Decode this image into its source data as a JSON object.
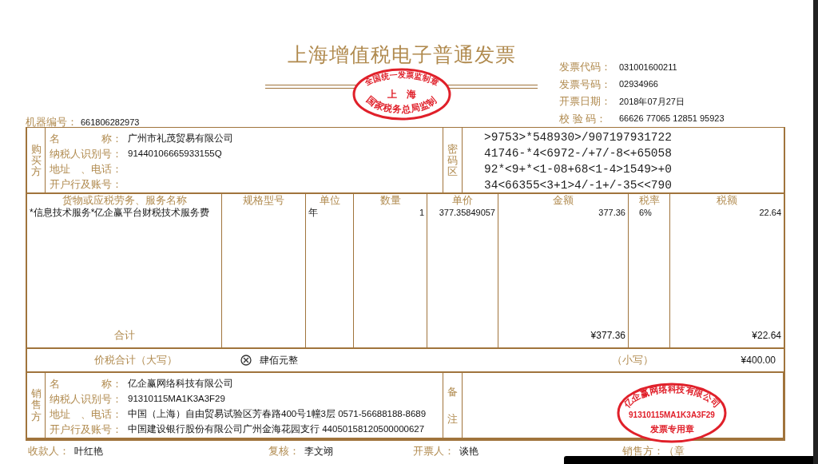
{
  "title": "上海增值税电子普通发票",
  "header_stamp": {
    "top_text": "全国统一发票监制章",
    "center_text": "上　海",
    "bottom_text": "国家税务总局监制"
  },
  "meta": [
    {
      "label": "发票代码：",
      "value": "031001600211"
    },
    {
      "label": "发票号码：",
      "value": "02934966"
    },
    {
      "label": "开票日期：",
      "value": "2018年07月27日"
    },
    {
      "label": "校 验 码：",
      "value": "66626 77065 12851 95923"
    }
  ],
  "machine_no": {
    "label": "机器编号：",
    "value": "661806282973"
  },
  "buyer": {
    "side_label": "购买方",
    "fields": [
      {
        "label": "名　　　　称：",
        "value": "广州市礼茂贸易有限公司"
      },
      {
        "label": "纳税人识别号：",
        "value": "91440106665933155Q"
      },
      {
        "label": "地址　、电话："
      },
      {
        "label": "开户行及账号："
      }
    ],
    "code_label": "密码区",
    "code_lines": [
      ">9753>*548930>/907197931722",
      "41746-*4<6972-/+7/-8<+65058",
      "92*<9+*<1-08+68<1-4>1549>+0",
      "34<66355<3+1>4/-1+/-35<<790"
    ]
  },
  "items": {
    "columns": [
      "货物或应税劳务、服务名称",
      "规格型号",
      "单位",
      "数量",
      "单价",
      "金额",
      "税率",
      "税额"
    ],
    "rows": [
      {
        "name": "*信息技术服务*亿企赢平台财税技术服务费",
        "unit": "年",
        "qty": "1",
        "price": "377.35849057",
        "amount": "377.36",
        "rate": "6%",
        "tax": "22.64"
      }
    ],
    "total": {
      "label": "合计",
      "amount": "¥377.36",
      "tax": "¥22.64"
    }
  },
  "grand_total": {
    "label": "价税合计（大写）",
    "words": "肆佰元整",
    "small_label": "（小写）",
    "small_value": "¥400.00"
  },
  "seller": {
    "side_label": "销售方",
    "fields": [
      {
        "label": "名　　　　称：",
        "value": "亿企赢网络科技有限公司"
      },
      {
        "label": "纳税人识别号：",
        "value": "91310115MA1K3A3F29"
      },
      {
        "label": "地址　、电话：",
        "value": "中国（上海）自由贸易试验区芳春路400号1幢3层 0571-56688188-8689"
      },
      {
        "label": "开户行及账号：",
        "value": "中国建设银行股份有限公司广州金海花园支行 44050158120500000627"
      }
    ],
    "remark_label": "备注",
    "stamp": {
      "top_text": "亿企赢网络科技有限公司",
      "center_text": "91310115MA1K3A3F29",
      "bottom_text": "发票专用章"
    }
  },
  "footer": [
    {
      "label": "收款人：",
      "value": "叶红艳"
    },
    {
      "label": "复核：",
      "value": "李文翊"
    },
    {
      "label": "开票人：",
      "value": "谈艳"
    },
    {
      "label": "销售方：（章"
    }
  ]
}
